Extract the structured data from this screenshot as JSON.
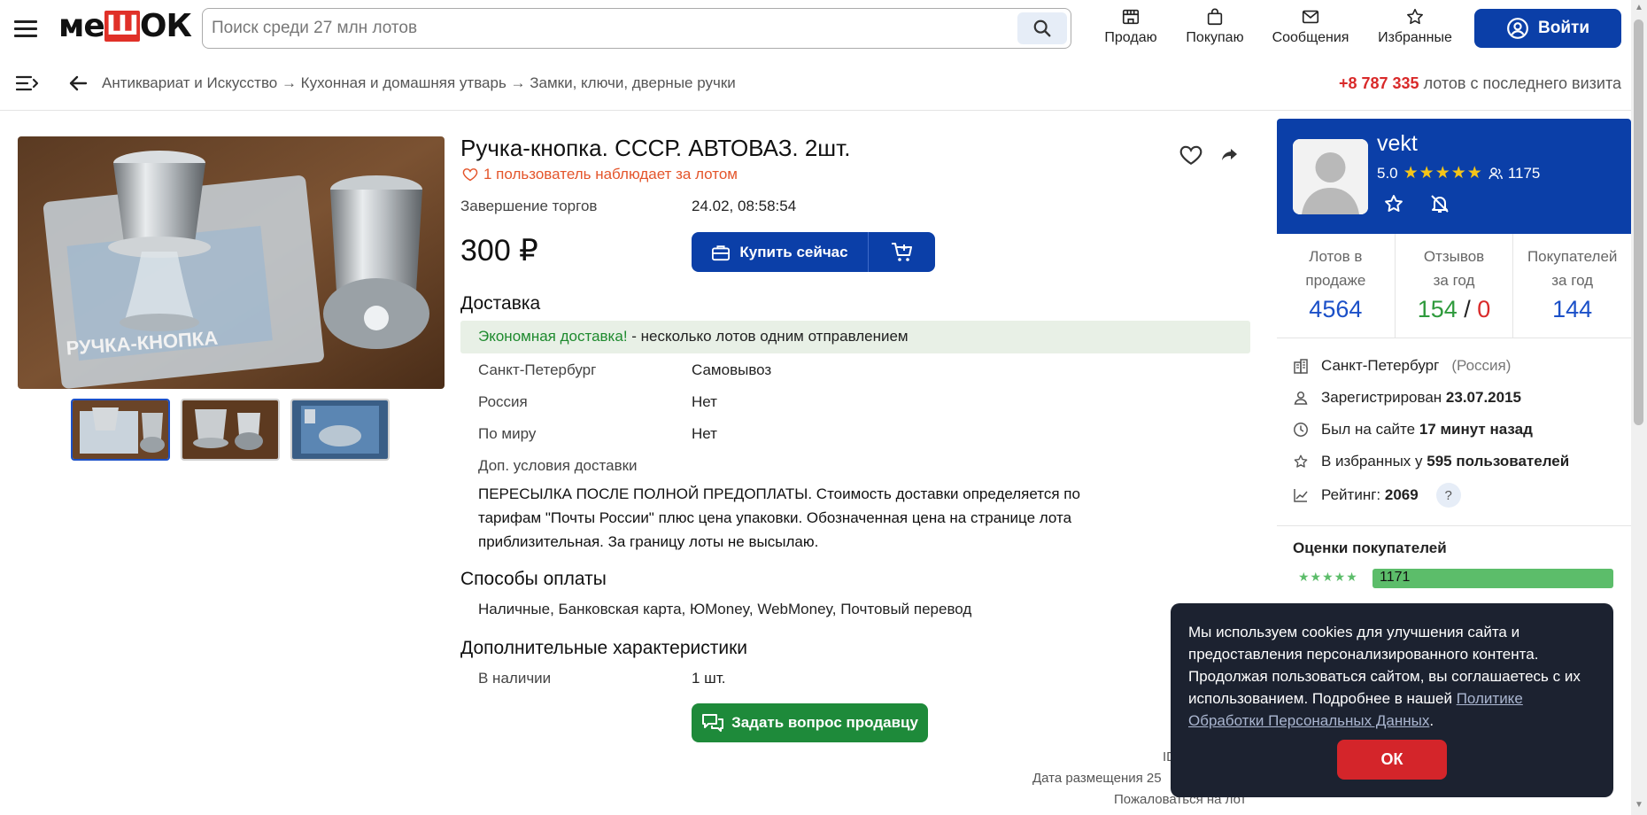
{
  "header": {
    "logo": {
      "left": "ме",
      "highlight": "Ш",
      "right": "ОК"
    },
    "search_placeholder": "Поиск среди 27 млн лотов",
    "nav": [
      {
        "label": "Продаю",
        "icon": "shop-icon"
      },
      {
        "label": "Покупаю",
        "icon": "bag-icon"
      },
      {
        "label": "Сообщения",
        "icon": "mail-icon"
      },
      {
        "label": "Избранные",
        "icon": "star-icon"
      }
    ],
    "login_label": "Войти"
  },
  "subnav": {
    "breadcrumb": "Антиквариат и Искусство → Кухонная и домашняя утварь → Замки, ключи, дверные ручки",
    "lots_count": "+8 787 335",
    "lots_text": " лотов с последнего визита"
  },
  "lot": {
    "title": "Ручка-кнопка. СССР. АВТОВАЗ. 2шт.",
    "watchers": "1 пользователь наблюдает за лотом",
    "end_label": "Завершение торгов",
    "end_value": "24.02, 08:58:54",
    "price": "300 ₽",
    "buy_label": "Купить сейчас",
    "delivery_title": "Доставка",
    "promo_green": "Экономная доставка!",
    "promo_rest": " - несколько лотов одним отправлением",
    "delivery": [
      {
        "label": "Санкт-Петербург",
        "value": "Самовывоз"
      },
      {
        "label": "Россия",
        "value": "Нет"
      },
      {
        "label": "По миру",
        "value": "Нет"
      }
    ],
    "extra_label": "Доп. условия доставки",
    "extra_text": "ПЕРЕСЫЛКА ПОСЛЕ ПОЛНОЙ ПРЕДОПЛАТЫ. Стоимость доставки определяется по тарифам \"Почты России\" плюс цена упаковки. Обозначенная цена на странице лота приблизительная. За границу лоты не высылаю.",
    "payment_title": "Способы оплаты",
    "payments": "Наличные, Банковская карта, ЮMoney, WebMoney, Почтовый перевод",
    "chars_title": "Дополнительные характеристики",
    "stock_label": "В наличии",
    "stock_value": "1 шт.",
    "ask_label": "Задать вопрос продавцу",
    "id_label": "ID",
    "placed_label": "Дата размещения 25",
    "complain_label": "Пожаловаться на лот",
    "photo_caption": "РУЧКА-КНОПКА"
  },
  "seller": {
    "name": "vekt",
    "rating": "5.0",
    "stars": "★★★★★",
    "followers": "1175",
    "stats": [
      {
        "label1": "Лотов в",
        "label2": "продаже",
        "value": "4564"
      },
      {
        "label1": "Отзывов",
        "label2": "за год",
        "pos": "154",
        "slash": " / ",
        "neg": "0"
      },
      {
        "label1": "Покупателей",
        "label2": "за год",
        "value": "144"
      }
    ],
    "city": "Санкт-Петербург",
    "country": "(Россия)",
    "registered_label": "Зарегистрирован",
    "registered_value": "23.07.2015",
    "seen_label": "Был на сайте",
    "seen_value": "17 минут назад",
    "fav_label": "В избранных у",
    "fav_value": "595 пользователей",
    "rating_label": "Рейтинг:",
    "rating_value": "2069",
    "help": "?",
    "ratings_title": "Оценки покупателей",
    "rating_stars": "★★★★★",
    "five_star_count": "1171"
  },
  "cookie": {
    "text": "Мы используем cookies для улучшения сайта и предоставления персонализированного контента. Продолжая пользоваться сайтом, вы соглашаетесь с их использованием. Подробнее в нашей ",
    "link": "Политике Обработки Персональных Данных",
    "end": ".",
    "ok": "ОК"
  },
  "colors": {
    "brand_blue": "#0b3fa8",
    "accent_red": "#d92a2a",
    "green": "#1e8a3a"
  }
}
